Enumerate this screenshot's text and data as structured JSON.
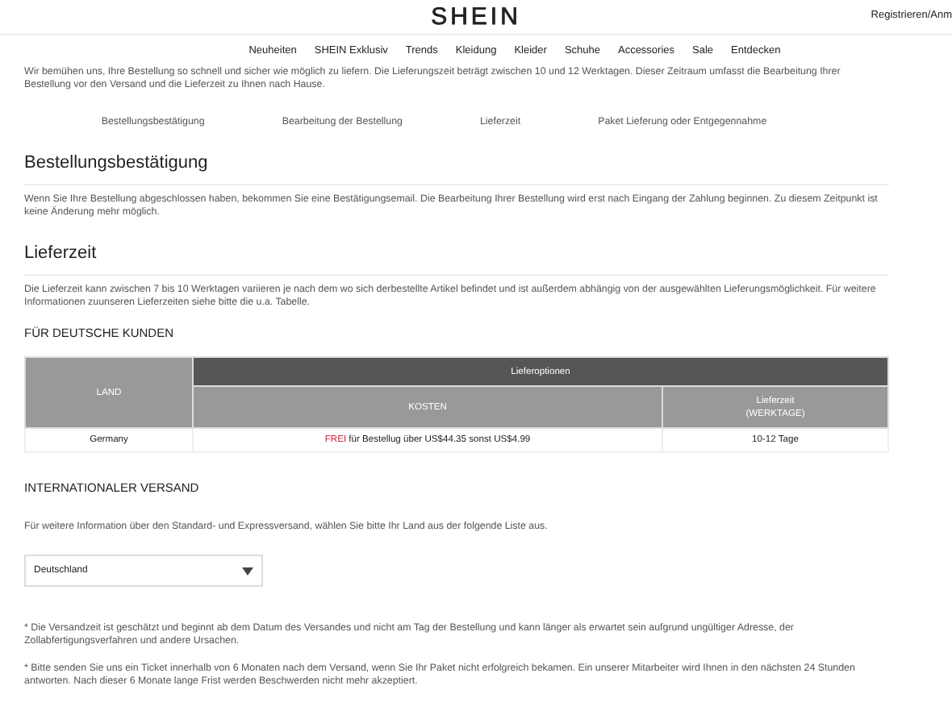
{
  "header": {
    "logo": "SHEIN",
    "account_link": "Registrieren/Anm"
  },
  "nav": [
    "Neuheiten",
    "SHEIN Exklusiv",
    "Trends",
    "Kleidung",
    "Kleider",
    "Schuhe",
    "Accessories",
    "Sale",
    "Entdecken"
  ],
  "intro": "Wir bemühen uns, Ihre Bestellung so schnell und sicher wie möglich zu liefern. Die Lieferungszeit beträgt zwischen 10 und 12 Werktagen. Dieser Zeitraum umfasst die Bearbeitung Ihrer Bestellung vor den Versand und die Lieferzeit zu Ihnen nach Hause.",
  "steps": [
    "Bestellungsbestätigung",
    "Bearbeitung der Bestellung",
    "Lieferzeit",
    "Paket Lieferung oder Entgegennahme"
  ],
  "sections": [
    {
      "title": "Bestellungsbestätigung",
      "text": "Wenn Sie Ihre Bestellung abgeschlossen haben, bekommen Sie eine Bestätigungsemail. Die Bearbeitung Ihrer Bestellung wird erst nach Eingang der Zahlung beginnen. Zu diesem Zeitpunkt ist keine Änderung mehr möglich."
    },
    {
      "title": "Lieferzeit",
      "text": "Die Lieferzeit kann zwischen 7 bis 10 Werktagen variieren je nach dem wo sich derbestellte Artikel befindet und ist außerdem abhängig von der ausgewählten Lieferungsmöglichkeit. Für weitere Informationen zuunseren Lieferzeiten siehe bitte die u.a. Tabelle."
    }
  ],
  "german_customers": {
    "title": "FÜR DEUTSCHE KUNDEN",
    "table": {
      "columns": {
        "land": "LAND",
        "group": "Lieferoptionen",
        "cost": "KOSTEN",
        "time": [
          "Lieferzeit",
          "(WERKTAGE)"
        ]
      },
      "rows": [
        {
          "land": "Germany",
          "cost_highlight": "FREI",
          "cost": "für Bestellug über US$44.35 sonst US$4.99",
          "time": "10-12 Tage"
        }
      ]
    }
  },
  "international": {
    "title": "INTERNATIONALER VERSAND",
    "text": "Für weitere Information über den Standard- und Expressversand, wählen Sie bitte Ihr Land aus der folgende Liste aus.",
    "country_select": "Deutschland"
  },
  "footnotes": [
    "* Die Versandzeit ist geschätzt und beginnt ab dem Datum des Versandes und nicht am Tag der Bestellung und kann länger als erwartet sein aufgrund ungültiger Adresse, der Zollabfertigungsverfahren und andere Ursachen.",
    "* Bitte senden Sie uns ein Ticket innerhalb von 6 Monaten nach dem Versand, wenn Sie Ihr Paket nicht erfolgreich bekamen. Ein unserer Mitarbeiter wird Ihnen in den nächsten 24 Stunden antworten. Nach dieser 6 Monate lange Frist werden Beschwerden nicht mehr akzeptiert."
  ]
}
